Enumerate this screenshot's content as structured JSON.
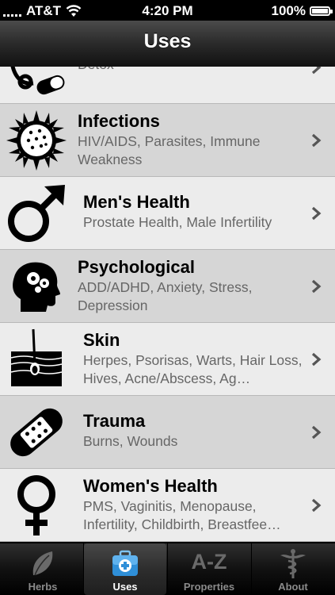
{
  "status_bar": {
    "carrier": "AT&T",
    "time": "4:20 PM",
    "battery": "100%",
    "battery_level": 1.0
  },
  "nav": {
    "title": "Uses"
  },
  "rows": [
    {
      "name": "",
      "desc": "Alcohol Detox, Drug Detox, Tobacco Detox",
      "icon": "detox-pills-icon"
    },
    {
      "name": "Infections",
      "desc": "HIV/AIDS, Parasites, Immune Weakness",
      "icon": "virus-icon"
    },
    {
      "name": "Men's Health",
      "desc": "Prostate Health, Male Infertility",
      "icon": "male-symbol-icon"
    },
    {
      "name": "Psychological",
      "desc": "ADD/ADHD, Anxiety, Stress, Depression",
      "icon": "head-gears-icon"
    },
    {
      "name": "Skin",
      "desc": "Herpes, Psorisas, Warts, Hair Loss, Hives, Acne/Abscess, Ag…",
      "icon": "skin-layer-icon"
    },
    {
      "name": "Trauma",
      "desc": "Burns, Wounds",
      "icon": "bandage-icon"
    },
    {
      "name": "Women's Health",
      "desc": "PMS, Vaginitis, Menopause, Infertility, Childbirth, Breastfee…",
      "icon": "female-symbol-icon"
    }
  ],
  "tabs": [
    {
      "label": "Herbs",
      "icon": "leaf-icon",
      "active": false
    },
    {
      "label": "Uses",
      "icon": "first-aid-kit-icon",
      "active": true
    },
    {
      "label": "Properties",
      "icon": "a-z-icon",
      "icon_text": "A-Z",
      "active": false
    },
    {
      "label": "About",
      "icon": "caduceus-icon",
      "active": false
    }
  ]
}
